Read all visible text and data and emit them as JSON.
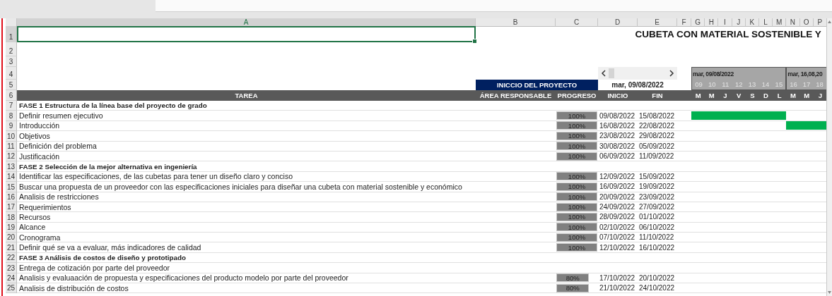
{
  "column_headers": [
    {
      "label": "A",
      "selected": true
    },
    {
      "label": "B",
      "selected": false
    },
    {
      "label": "C",
      "selected": false
    },
    {
      "label": "D",
      "selected": false
    },
    {
      "label": "E",
      "selected": false
    },
    {
      "label": "F",
      "selected": false
    },
    {
      "label": "G",
      "selected": false
    },
    {
      "label": "H",
      "selected": false
    },
    {
      "label": "I",
      "selected": false
    },
    {
      "label": "J",
      "selected": false
    },
    {
      "label": "K",
      "selected": false
    },
    {
      "label": "L",
      "selected": false
    },
    {
      "label": "M",
      "selected": false
    },
    {
      "label": "N",
      "selected": false
    },
    {
      "label": "O",
      "selected": false
    },
    {
      "label": "P",
      "selected": false
    }
  ],
  "header_rows": [
    {
      "number": "1",
      "selected": true
    },
    {
      "number": "2",
      "selected": false
    },
    {
      "number": "3",
      "selected": false
    },
    {
      "number": "4",
      "selected": false
    },
    {
      "number": "5",
      "selected": false
    },
    {
      "number": "6",
      "selected": false
    }
  ],
  "title": "CUBETA CON MATERIAL SOSTENIBLE Y",
  "project_start": {
    "label": "INICCIO DEL PROYECTO",
    "value": "mar, 09/08/2022"
  },
  "weeks": [
    {
      "label": "mar, 09/08/2022",
      "days": [
        {
          "number": "09",
          "weekday": "M"
        },
        {
          "number": "10",
          "weekday": "M"
        },
        {
          "number": "11",
          "weekday": "J"
        },
        {
          "number": "12",
          "weekday": "V"
        },
        {
          "number": "13",
          "weekday": "S"
        },
        {
          "number": "14",
          "weekday": "D"
        },
        {
          "number": "15",
          "weekday": "L"
        }
      ]
    },
    {
      "label": "mar, 16,08,20",
      "days": [
        {
          "number": "16",
          "weekday": "M"
        },
        {
          "number": "17",
          "weekday": "M"
        },
        {
          "number": "18",
          "weekday": "J"
        }
      ]
    }
  ],
  "columns": [
    "TAREA",
    "ÁREA RESPONSABLE",
    "PROGRESO",
    "INICIO",
    "FIN"
  ],
  "rows": [
    {
      "number": "7",
      "kind": "phase",
      "task": "FASE 1 Estructura de la línea base del proyecto de grado"
    },
    {
      "number": "8",
      "kind": "task",
      "task": "Definir resumen ejecutivo",
      "progress": "100%",
      "level": 1,
      "start": "09/08/2022",
      "end": "15/08/2022",
      "timeline": [
        true,
        false
      ]
    },
    {
      "number": "9",
      "kind": "task",
      "task": "Introducción",
      "progress": "100%",
      "level": 1,
      "start": "16/08/2022",
      "end": "22/08/2022",
      "timeline": [
        false,
        true
      ]
    },
    {
      "number": "10",
      "kind": "task",
      "task": "Objetivos",
      "progress": "100%",
      "level": 1,
      "start": "23/08/2022",
      "end": "29/08/2022"
    },
    {
      "number": "11",
      "kind": "task",
      "task": "Definición del problema",
      "progress": "100%",
      "level": 1,
      "start": "30/08/2022",
      "end": "05/09/2022"
    },
    {
      "number": "12",
      "kind": "task",
      "task": "Justificación",
      "progress": "100%",
      "level": 1,
      "start": "06/09/2022",
      "end": "11/09/2022"
    },
    {
      "number": "13",
      "kind": "phase",
      "task": "FASE 2 Selección de la mejor alternativa en ingeniería"
    },
    {
      "number": "14",
      "kind": "task",
      "task": "Identificar las especificaciones, de las cubetas para tener un diseño claro y conciso",
      "progress": "100%",
      "level": 1,
      "start": "12/09/2022",
      "end": "15/09/2022"
    },
    {
      "number": "15",
      "kind": "task",
      "task": "Buscar una propuesta de un proveedor con las especificaciones iniciales para diseñar una cubeta con material sostenible y económico",
      "progress": "100%",
      "level": 1,
      "start": "16/09/2022",
      "end": "19/09/2022"
    },
    {
      "number": "16",
      "kind": "task",
      "task": "Analisis de restricciones",
      "progress": "100%",
      "level": 1,
      "start": "20/09/2022",
      "end": "23/09/2022"
    },
    {
      "number": "17",
      "kind": "task",
      "task": "Requerimientos",
      "progress": "100%",
      "level": 1,
      "start": "24/09/2022",
      "end": "27/09/2022"
    },
    {
      "number": "18",
      "kind": "task",
      "task": "Recursos",
      "progress": "100%",
      "level": 1,
      "start": "28/09/2022",
      "end": "01/10/2022"
    },
    {
      "number": "19",
      "kind": "task",
      "task": "Alcance",
      "progress": "100%",
      "level": 1,
      "start": "02/10/2022",
      "end": "06/10/2022"
    },
    {
      "number": "20",
      "kind": "task",
      "task": "Cronograma",
      "progress": "100%",
      "level": 1,
      "start": "07/10/2022",
      "end": "11/10/2022"
    },
    {
      "number": "21",
      "kind": "task",
      "task": "Definir qué se va a evaluar, más indicadores de calidad",
      "progress": "100%",
      "level": 1,
      "start": "12/10/2022",
      "end": "16/10/2022"
    },
    {
      "number": "22",
      "kind": "phase",
      "task": "FASE 3 Análisis de costos de diseño y prototipado"
    },
    {
      "number": "23",
      "kind": "task",
      "task": "Entrega de cotización por parte del proveedor"
    },
    {
      "number": "24",
      "kind": "task",
      "task": "Analisis y evaluaación de propuesta y especificaciones del producto modelo por parte del proveedor",
      "progress": "80%",
      "level": 0.8,
      "start": "17/10/2022",
      "end": "20/10/2022"
    },
    {
      "number": "25",
      "kind": "task",
      "task": "Analisis de distribución de costos",
      "progress": "80%",
      "level": 0.8,
      "start": "21/10/2022",
      "end": "24/10/2022"
    }
  ]
}
